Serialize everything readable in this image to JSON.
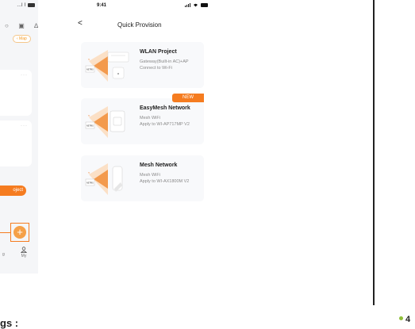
{
  "left_phone": {
    "status_glyphs": "…l ⌇",
    "map_button": "‹ Map",
    "card_dots": "···",
    "project_button": "oject",
    "fab_symbol": "+",
    "nav_left_label": "g",
    "nav_my_label": "My"
  },
  "bottom_left_text": "gs :",
  "status_bar": {
    "time": "9:41"
  },
  "nav": {
    "back_symbol": "<",
    "title": "Quick Provision"
  },
  "cards": [
    {
      "title": "WLAN Project",
      "line1": "Gateway(Built-in AC)+AP",
      "line2": "Connect to Wi-Fi",
      "badge": ""
    },
    {
      "title": "EasyMesh Network",
      "line1": "Mesh WiFi",
      "line2": "Apply to WI-AP717MP V2",
      "badge": "NEW"
    },
    {
      "title": "Mesh Network",
      "line1": "Mesh WiFi",
      "line2": "Apply to WI-AX1800M V2",
      "badge": ""
    }
  ],
  "colors": {
    "accent": "#f57c20",
    "card_bg": "#f8f9fb"
  },
  "right": {
    "number": "4"
  }
}
